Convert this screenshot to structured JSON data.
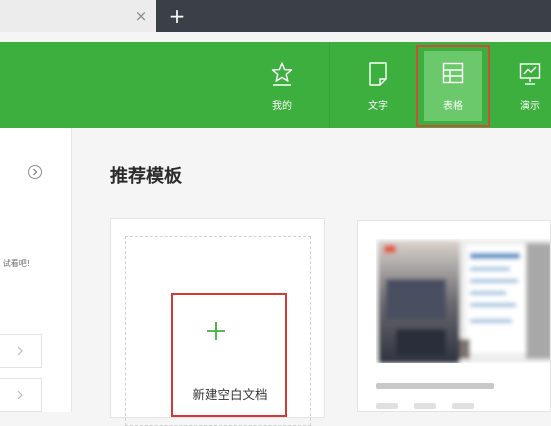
{
  "tabbar": {
    "close_glyph": "×",
    "new_tab_glyph": "+"
  },
  "header": {
    "nav": [
      {
        "id": "mine",
        "label": "我的",
        "icon": "star-icon"
      },
      {
        "id": "doc",
        "label": "文字",
        "icon": "document-icon"
      },
      {
        "id": "sheet",
        "label": "表格",
        "icon": "table-icon",
        "selected": true
      },
      {
        "id": "slides",
        "label": "演示",
        "icon": "presentation-icon"
      }
    ]
  },
  "sidebar": {
    "text": "试看吧!"
  },
  "main": {
    "section_title": "推荐模板",
    "new_blank": {
      "plus": "+",
      "label": "新建空白文档"
    }
  },
  "colors": {
    "header_green": "#3daf3f",
    "selected_tile": "#6cc96b",
    "highlight_red": "#d33a34"
  }
}
